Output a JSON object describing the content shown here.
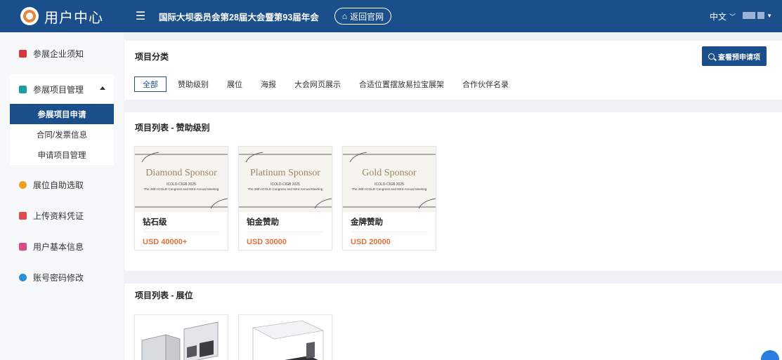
{
  "header": {
    "brand_title": "用户中心",
    "menu_icon": "menu-icon",
    "conference_title": "国际大坝委员会第28届大会暨第93届年会",
    "back_label": "返回官网",
    "language": "中文",
    "colors": {
      "primary": "#1b4f8c",
      "accent_price": "#e0703a"
    }
  },
  "sidebar": {
    "items": [
      {
        "label": "参展企业须知",
        "icon": "notice-icon",
        "color": "#d9363e"
      },
      {
        "label": "参展项目管理",
        "icon": "project-icon",
        "color": "#1aa0a0"
      },
      {
        "label": "展位自助选取",
        "icon": "booth-icon",
        "color": "#f0a020"
      },
      {
        "label": "上传资料凭证",
        "icon": "folder-icon",
        "color": "#e04b4b"
      },
      {
        "label": "用户基本信息",
        "icon": "user-card-icon",
        "color": "#d94c8a"
      },
      {
        "label": "账号密码修改",
        "icon": "lock-icon",
        "color": "#2a8fd6"
      }
    ],
    "sub_items": [
      {
        "label": "参展项目申请",
        "active": true
      },
      {
        "label": "合同/发票信息",
        "active": false
      },
      {
        "label": "申请项目管理",
        "active": false
      }
    ]
  },
  "category": {
    "title": "项目分类",
    "search_button": "查看预申请项",
    "tabs": [
      "全部",
      "赞助级别",
      "展位",
      "海报",
      "大会网页展示",
      "合适位置摆放易拉宝展架",
      "合作伙伴名录"
    ],
    "active_tab": "全部"
  },
  "sponsor_list": {
    "title": "项目列表 - 赞助级别",
    "poster_line1": "ICOLD-CIGB 2025",
    "poster_line2": "The 28th ICOLD Congress and 93rd Annual Meeting",
    "items": [
      {
        "poster_title": "Diamond Sponsor",
        "name": "钻石级",
        "price": "USD 40000+"
      },
      {
        "poster_title": "Platinum Sponsor",
        "name": "铂金赞助",
        "price": "USD 30000"
      },
      {
        "poster_title": "Gold Sponsor",
        "name": "金牌赞助",
        "price": "USD 20000"
      }
    ]
  },
  "booth_list": {
    "title": "项目列表 - 展位"
  }
}
